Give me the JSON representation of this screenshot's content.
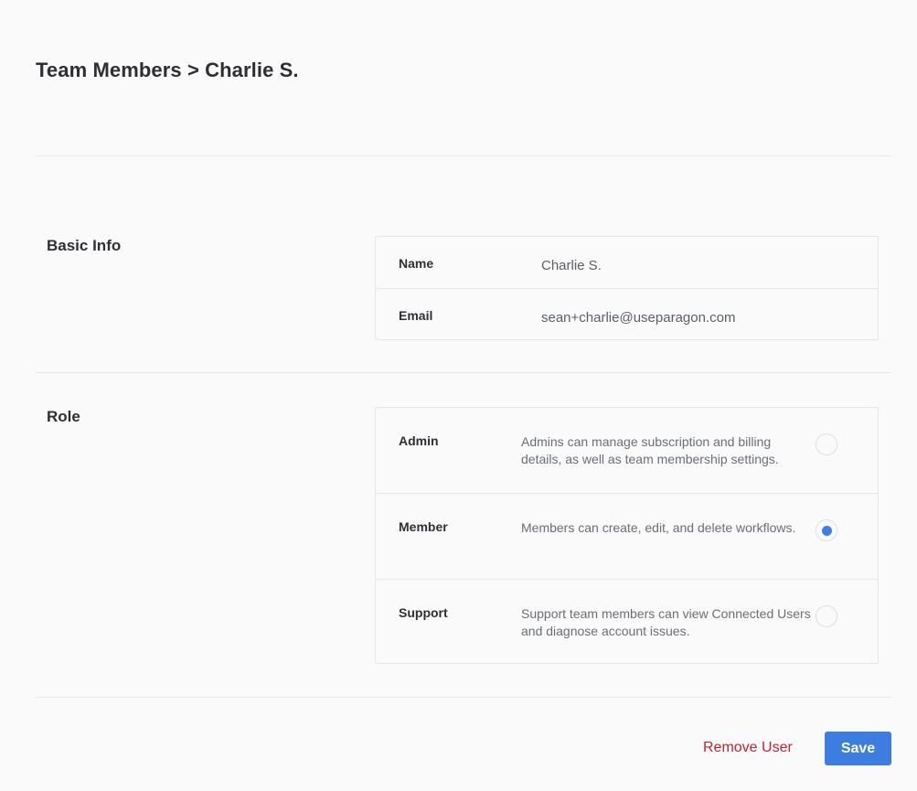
{
  "header": {
    "title": "Team Members > Charlie S."
  },
  "basic_info": {
    "section_title": "Basic Info",
    "rows": [
      {
        "label": "Name",
        "value": "Charlie S."
      },
      {
        "label": "Email",
        "value": "sean+charlie@useparagon.com"
      }
    ]
  },
  "role": {
    "section_title": "Role",
    "options": [
      {
        "label": "Admin",
        "description": "Admins can manage subscription and billing details, as well as team membership settings.",
        "selected": false
      },
      {
        "label": "Member",
        "description": "Members can create, edit, and delete workflows.",
        "selected": true
      },
      {
        "label": "Support",
        "description": "Support team members can view Connected Users and diagnose account issues.",
        "selected": false
      }
    ]
  },
  "actions": {
    "remove_label": "Remove User",
    "save_label": "Save"
  },
  "colors": {
    "accent": "#3c7ddf",
    "danger": "#c0262d",
    "background": "#fafafb"
  }
}
